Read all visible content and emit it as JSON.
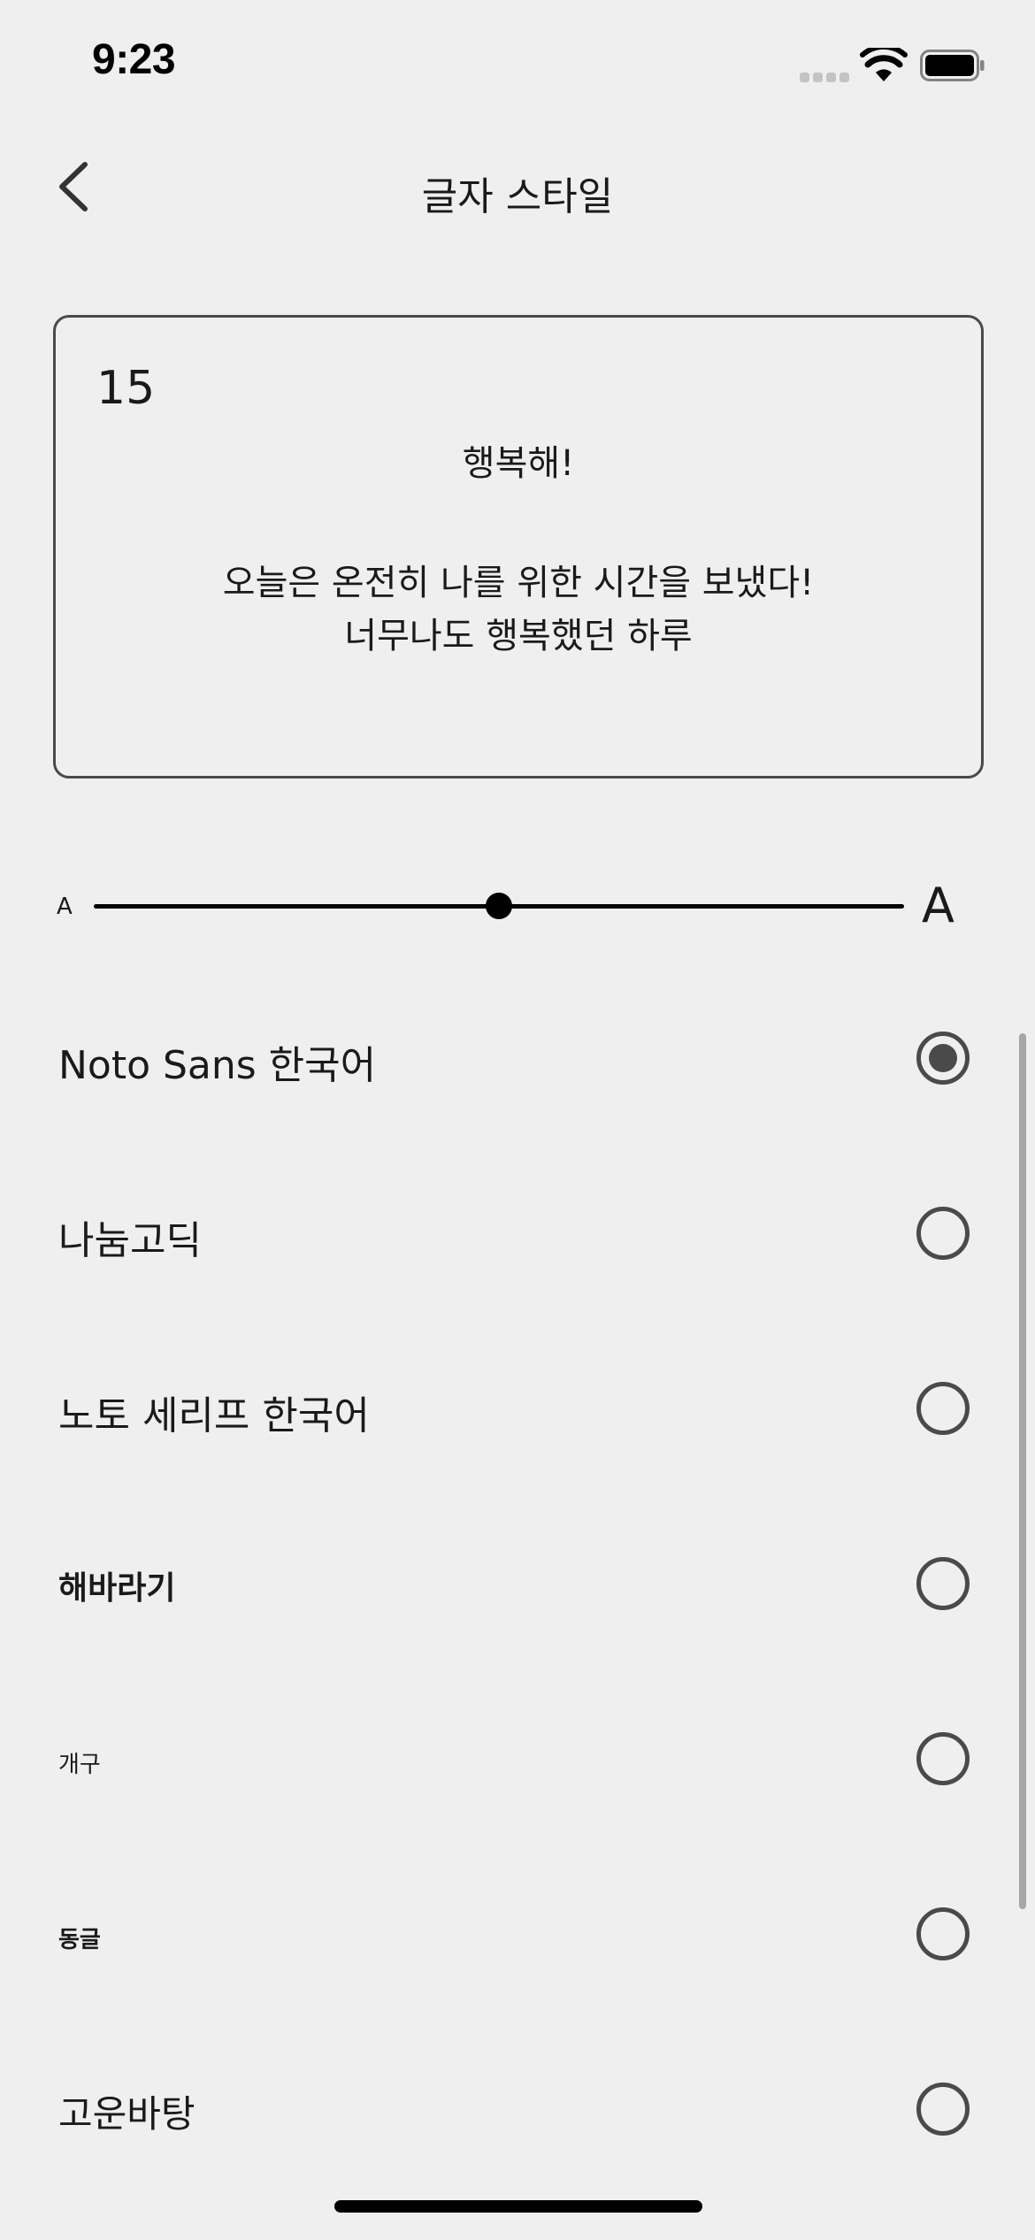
{
  "status_bar": {
    "time": "9:23"
  },
  "header": {
    "title": "글자 스타일"
  },
  "preview": {
    "date": "15",
    "title": "행복해!",
    "body_line1": "오늘은 온전히 나를 위한 시간을 보냈다!",
    "body_line2": "너무나도 행복했던 하루"
  },
  "size_slider": {
    "small_label": "A",
    "large_label": "A",
    "value_fraction": 0.5
  },
  "fonts": [
    {
      "label": "Noto Sans 한국어",
      "selected": true
    },
    {
      "label": "나눔고딕",
      "selected": false
    },
    {
      "label": "노토 세리프 한국어",
      "selected": false
    },
    {
      "label": "해바라기",
      "selected": false
    },
    {
      "label": "개구",
      "selected": false
    },
    {
      "label": "동글",
      "selected": false
    },
    {
      "label": "고운바탕",
      "selected": false
    }
  ],
  "colors": {
    "background": "#efefef",
    "border": "#4a4a4a",
    "text": "#1a1a1a"
  },
  "icons": [
    "signal-icon",
    "wifi-icon",
    "battery-icon",
    "chevron-left-icon",
    "radio-icon"
  ]
}
